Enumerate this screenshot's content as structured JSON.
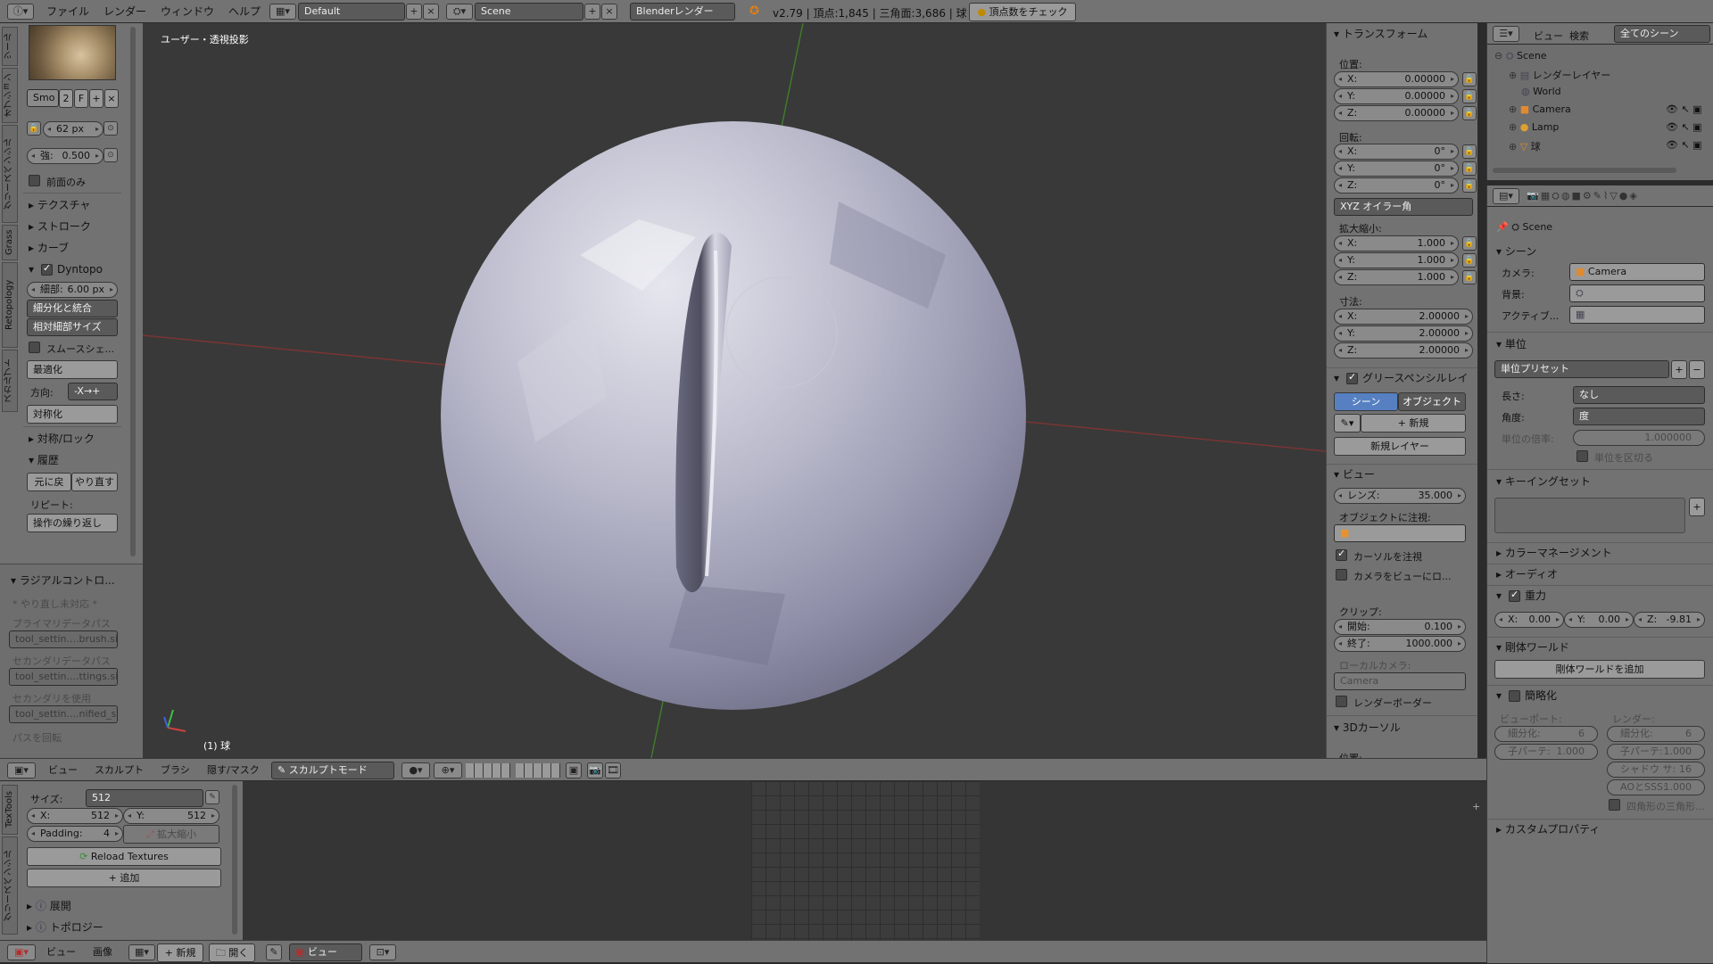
{
  "topbar": {
    "menus": [
      "ファイル",
      "レンダー",
      "ウィンドウ",
      "ヘルプ"
    ],
    "layout": "Default",
    "scene": "Scene",
    "engine": "Blenderレンダー",
    "stats": "v2.79 | 頂点:1,845 | 三角面:3,686 | 球",
    "check_btn": "頂点数をチェック"
  },
  "toolshelf": {
    "tabs": [
      "ツール",
      "オプション",
      "グリースペンシル",
      "Grass",
      "Retopology",
      "スカルプト"
    ],
    "brush_name": "Smo",
    "brush_users": "2",
    "brush_fake": "F",
    "radius": "62 px",
    "strength_label": "強:",
    "strength": "0.500",
    "front_only": "前面のみ",
    "texture": "テクスチャ",
    "stroke": "ストローク",
    "curve": "カーブ",
    "dyntopo": "Dyntopo",
    "detail_label": "細部:",
    "detail_value": "6.00 px",
    "refine_method": "細分化と統合",
    "detail_type": "相対細部サイズ",
    "smooth_shading": "スムースシェ...",
    "optimize": "最適化",
    "direction_label": "方向:",
    "direction_value": "-X→+",
    "symmetrize": "対称化",
    "symmetry_lock": "対称/ロック",
    "history": "履歴",
    "undo": "元に戻",
    "redo": "やり直す",
    "repeat_label": "リピート:",
    "repeat_btn": "操作の繰り返し"
  },
  "radial": {
    "title": "ラジアルコントロ...",
    "undo_note": "* やり直し未対応 *",
    "primary_label": "プライマリデータパス",
    "primary_value": "tool_settin....brush.size",
    "secondary_label": "セカンダリデータパス",
    "secondary_value": "tool_settin....ttings.size",
    "use_secondary_label": "セカンダリを使用",
    "use_secondary_value": "tool_settin....nified_size",
    "rotation_path": "パスを回転"
  },
  "viewport": {
    "view_label": "ユーザー・透視投影",
    "object_label": "(1) 球",
    "header_menus": [
      "ビュー",
      "スカルプト",
      "ブラシ",
      "隠す/マスク"
    ],
    "mode": "スカルプトモード"
  },
  "npanel": {
    "transform": "トランスフォーム",
    "location": "位置:",
    "loc": [
      {
        "axis": "X:",
        "value": "0.00000"
      },
      {
        "axis": "Y:",
        "value": "0.00000"
      },
      {
        "axis": "Z:",
        "value": "0.00000"
      }
    ],
    "rotation": "回転:",
    "rot": [
      {
        "axis": "X:",
        "value": "0°"
      },
      {
        "axis": "Y:",
        "value": "0°"
      },
      {
        "axis": "Z:",
        "value": "0°"
      }
    ],
    "rot_mode": "XYZ オイラー角",
    "scale": "拡大縮小:",
    "scl": [
      {
        "axis": "X:",
        "value": "1.000"
      },
      {
        "axis": "Y:",
        "value": "1.000"
      },
      {
        "axis": "Z:",
        "value": "1.000"
      }
    ],
    "dimensions": "寸法:",
    "dim": [
      {
        "axis": "X:",
        "value": "2.00000"
      },
      {
        "axis": "Y:",
        "value": "2.00000"
      },
      {
        "axis": "Z:",
        "value": "2.00000"
      }
    ],
    "grease_pencil": "グリースペンシルレイ",
    "gp_scene": "シーン",
    "gp_object": "オブジェクト",
    "gp_new": "新規",
    "gp_new_layer": "新規レイヤー",
    "view": "ビュー",
    "lens_label": "レンズ:",
    "lens_value": "35.000",
    "lock_to_object": "オブジェクトに注視:",
    "lock_cursor": "カーソルを注視",
    "lock_camera": "カメラをビューにロ...",
    "clip": "クリップ:",
    "clip_start_label": "開始:",
    "clip_start": "0.100",
    "clip_end_label": "終了:",
    "clip_end": "1000.000",
    "local_camera": "ローカルカメラ:",
    "local_camera_value": "Camera",
    "render_border": "レンダーボーダー",
    "cursor_3d": "3Dカーソル",
    "cursor_loc": "位置:"
  },
  "outliner": {
    "menus": [
      "ビュー",
      "検索"
    ],
    "filter": "全てのシーン",
    "items": [
      "Scene",
      "レンダーレイヤー",
      "World",
      "Camera",
      "Lamp",
      "球"
    ]
  },
  "properties": {
    "breadcrumb": "Scene",
    "scene_panel": "シーン",
    "camera_label": "カメラ:",
    "camera_value": "Camera",
    "background_label": "背景:",
    "active_label": "アクティブ...",
    "units_panel": "単位",
    "unit_presets": "単位プリセット",
    "length_label": "長さ:",
    "length_value": "なし",
    "angle_label": "角度:",
    "angle_value": "度",
    "unit_scale_label": "単位の倍率:",
    "unit_scale_value": "1.000000",
    "separate_units": "単位を区切る",
    "keying_sets": "キーイングセット",
    "color_management": "カラーマネージメント",
    "audio": "オーディオ",
    "gravity": "重力",
    "gravity_x": "0.00",
    "gravity_y": "0.00",
    "gravity_z": "-9.81",
    "rigidbody_world": "剛体ワールド",
    "add_rigidbody": "剛体ワールドを追加",
    "simplify": "簡略化",
    "viewport_label": "ビューポート:",
    "render_label": "レンダー:",
    "subdiv_label": "細分化:",
    "subdiv_vp": "6",
    "subdiv_r": "6",
    "child_label": "子パーテ:",
    "child_vp": "1.000",
    "child_r": "1.000",
    "shadow_label": "シャドウ サ:",
    "shadow_r": "16",
    "ao_label": "AOとSSS:",
    "ao_r": "1.000",
    "cull_label": "四角形の三角形...",
    "custom_props": "カスタムプロパティ"
  },
  "textools": {
    "tabs": [
      "TexTools",
      "グリースペンシル"
    ],
    "size_label": "サイズ:",
    "size_value": "512",
    "x_label": "X:",
    "x_value": "512",
    "y_label": "Y:",
    "y_value": "512",
    "padding_label": "Padding:",
    "padding_value": "4",
    "zoom_label": "拡大縮小",
    "reload": "Reload Textures",
    "add": "追加",
    "unfold": "展開",
    "topology": "トポロジー"
  },
  "imageeditor": {
    "menus": [
      "ビュー",
      "画像"
    ],
    "new": "新規",
    "open": "開く",
    "view": "ビュー"
  }
}
